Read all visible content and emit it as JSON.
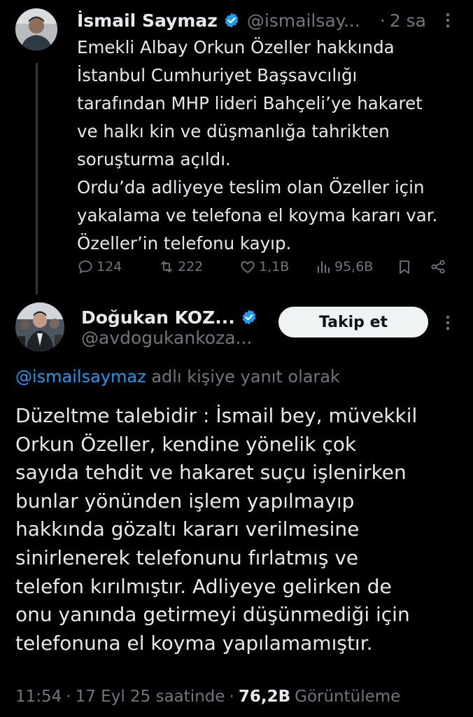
{
  "parent_tweet": {
    "author_name": "İsmail Saymaz",
    "handle": "@ismailsay...",
    "separator": "·",
    "time": "2 sa",
    "lines": [
      "Emekli Albay Orkun Özeller hakkında",
      "İstanbul Cumhuriyet Başsavcılığı",
      "tarafından MHP lideri Bahçeli’ye hakaret",
      "ve halkı kin ve düşmanlığa tahrikten",
      "soruşturma açıldı.",
      "Ordu’da adliyeye teslim olan Özeller için",
      "yakalama ve telefona el koyma kararı var.",
      "Özeller’in telefonu kayıp."
    ],
    "stats": {
      "replies": "124",
      "retweets": "222",
      "likes": "1,1B",
      "views": "95,6B"
    }
  },
  "main_tweet": {
    "author_name": "Doğukan KOZ...",
    "handle": "@avdogukankoza...",
    "follow_label": "Takip et",
    "reply_to_mention": "@ismailsaymaz",
    "reply_to_suffix": " adlı kişiye yanıt olarak",
    "lines": [
      "Düzeltme talebidir : İsmail bey, müvekkil",
      "Orkun Özeller, kendine yönelik çok",
      "sayıda tehdit ve hakaret suçu işlenirken",
      "bunlar yönünden işlem yapılmayıp",
      "hakkında gözaltı kararı verilmesine",
      "sinirlenerek telefonunu fırlatmış ve",
      "telefon kırılmıştır. Adliyeye gelirken de",
      "onu yanında getirmeyi düşünmediği için",
      "telefonuna el koyma yapılamamıştır."
    ],
    "time": "11:54",
    "dot1": "·",
    "date": "17 Eyl 25 saatinde",
    "dot2": "·",
    "views_count": "76,2B",
    "views_label": "Görüntüleme"
  },
  "icons": {
    "verified": "verified-badge-icon",
    "more": "more-vertical-icon",
    "reply": "reply-bubble-icon",
    "retweet": "retweet-icon",
    "like": "heart-icon",
    "views": "views-bar-icon",
    "bookmark": "bookmark-icon",
    "share": "share-icon"
  },
  "colors": {
    "background": "#000000",
    "text": "#e7e9ea",
    "muted": "#71767b",
    "accent": "#1d9bf0",
    "follow_bg": "#eff3f4"
  }
}
